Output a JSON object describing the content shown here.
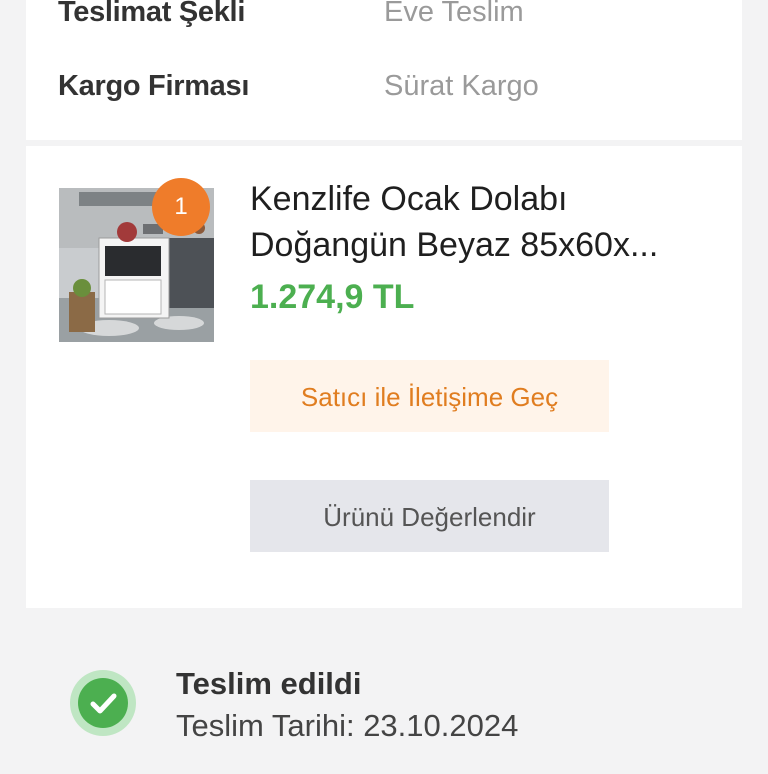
{
  "shipping_info": {
    "delivery_method_label": "Teslimat Şekli",
    "delivery_method_value": "Eve Teslim",
    "cargo_company_label": "Kargo Firması",
    "cargo_company_value": "Sürat Kargo"
  },
  "product": {
    "quantity": "1",
    "title": "Kenzlife Ocak Dolabı Doğangün Beyaz 85x60x...",
    "price": "1.274,9 TL",
    "contact_seller_label": "Satıcı ile İletişime Geç",
    "review_label": "Ürünü Değerlendir"
  },
  "status": {
    "title": "Teslim edildi",
    "date_text": "Teslim Tarihi: 23.10.2024",
    "icon": "check-circle-icon"
  },
  "colors": {
    "accent_orange": "#ef7c2a",
    "price_green": "#4caf50",
    "contact_bg": "#fff4ea",
    "review_bg": "#e5e6eb"
  }
}
